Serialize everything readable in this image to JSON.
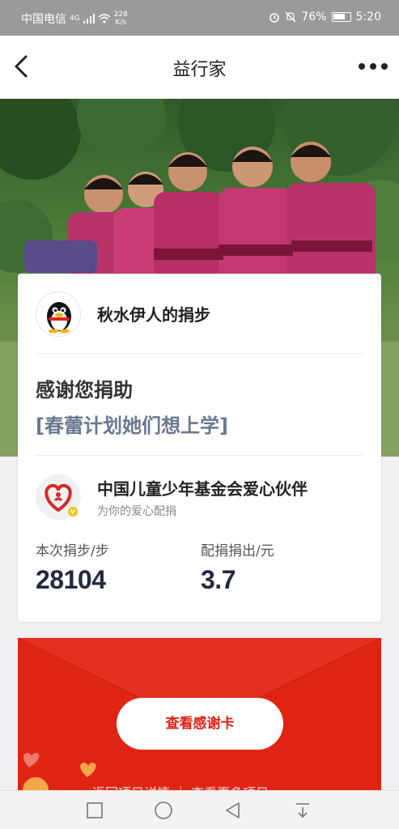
{
  "status_bar": {
    "carrier": "中国电信",
    "network": "4G",
    "speed_value": "228",
    "speed_unit": "K/s",
    "battery": "76%",
    "time": "5:20"
  },
  "nav": {
    "title": "益行家"
  },
  "card": {
    "username": "秋水伊人的捐步",
    "thanks": "感谢您捐助",
    "project": "[春蕾计划她们想上学]",
    "org_name": "中国儿童少年基金会爱心伙伴",
    "org_subtitle": "为你的爱心配捐",
    "steps_label": "本次捐步/步",
    "steps_value": "28104",
    "match_label": "配捐捐出/元",
    "match_value": "3.7"
  },
  "envelope": {
    "button_label": "查看感谢卡",
    "links_text": "返回项目详情 ｜ 查看更多项目"
  },
  "colors": {
    "accent_red": "#e02414",
    "navy_text": "#232a3f",
    "project_text": "#6b7890"
  }
}
